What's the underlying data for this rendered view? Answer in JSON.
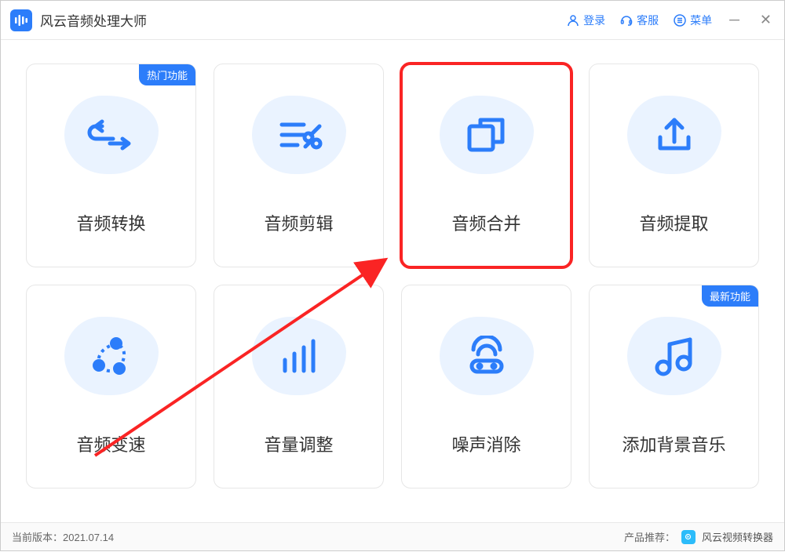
{
  "app": {
    "title": "风云音频处理大师",
    "login": "登录",
    "support": "客服",
    "menu": "菜单"
  },
  "badges": {
    "hot": "热门功能",
    "new": "最新功能"
  },
  "cards": [
    {
      "label": "音频转换"
    },
    {
      "label": "音频剪辑"
    },
    {
      "label": "音频合并"
    },
    {
      "label": "音频提取"
    },
    {
      "label": "音频变速"
    },
    {
      "label": "音量调整"
    },
    {
      "label": "噪声消除"
    },
    {
      "label": "添加背景音乐"
    }
  ],
  "footer": {
    "version_label": "当前版本：",
    "version": "2021.07.14",
    "recommend_label": "产品推荐：",
    "recommend_product": "风云视频转换器"
  },
  "colors": {
    "accent": "#2c7dfa",
    "highlight": "#fa2424",
    "blob": "#eaf3ff"
  }
}
